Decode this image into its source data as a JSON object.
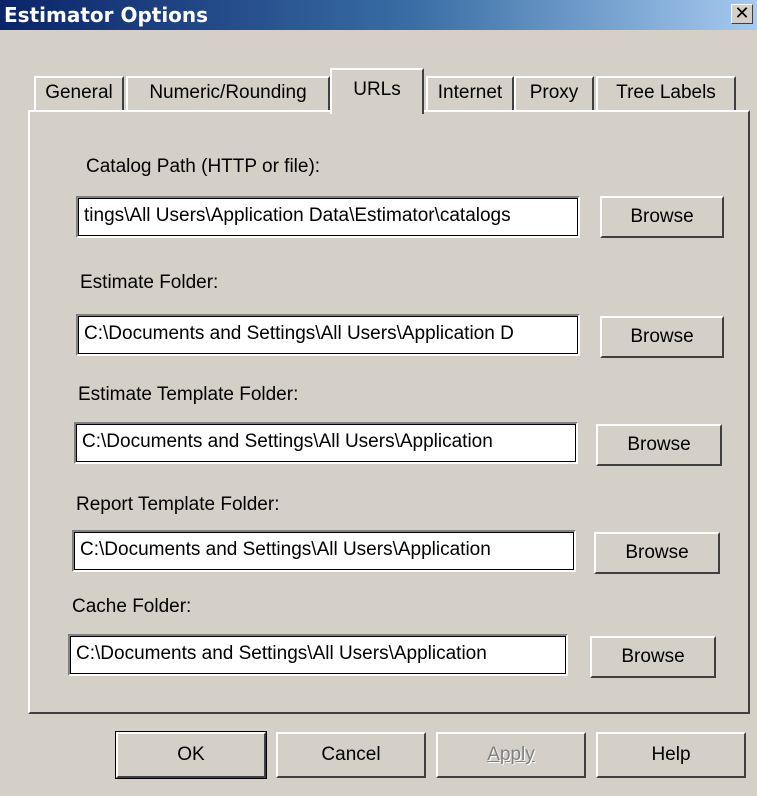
{
  "window": {
    "title": "Estimator Options",
    "close_glyph": "✕"
  },
  "tabs": [
    {
      "label": "General",
      "active": false
    },
    {
      "label": "Numeric/Rounding",
      "active": false
    },
    {
      "label": "URLs",
      "active": true
    },
    {
      "label": "Internet",
      "active": false
    },
    {
      "label": "Proxy",
      "active": false
    },
    {
      "label": "Tree Labels",
      "active": false
    }
  ],
  "fields": {
    "catalog_path": {
      "label": "Catalog Path (HTTP or file):",
      "value": "tings\\All Users\\Application Data\\Estimator\\catalogs",
      "browse": "Browse"
    },
    "estimate_folder": {
      "label": "Estimate Folder:",
      "value": "C:\\Documents and Settings\\All Users\\Application D",
      "browse": "Browse"
    },
    "estimate_template_folder": {
      "label": "Estimate Template Folder:",
      "value": "C:\\Documents and Settings\\All Users\\Application",
      "browse": "Browse"
    },
    "report_template_folder": {
      "label": "Report Template Folder:",
      "value": "C:\\Documents and Settings\\All Users\\Application",
      "browse": "Browse"
    },
    "cache_folder": {
      "label": "Cache Folder:",
      "value": "C:\\Documents and Settings\\All Users\\Application",
      "browse": "Browse"
    }
  },
  "buttons": {
    "ok": "OK",
    "cancel": "Cancel",
    "apply": "Apply",
    "help": "Help"
  }
}
